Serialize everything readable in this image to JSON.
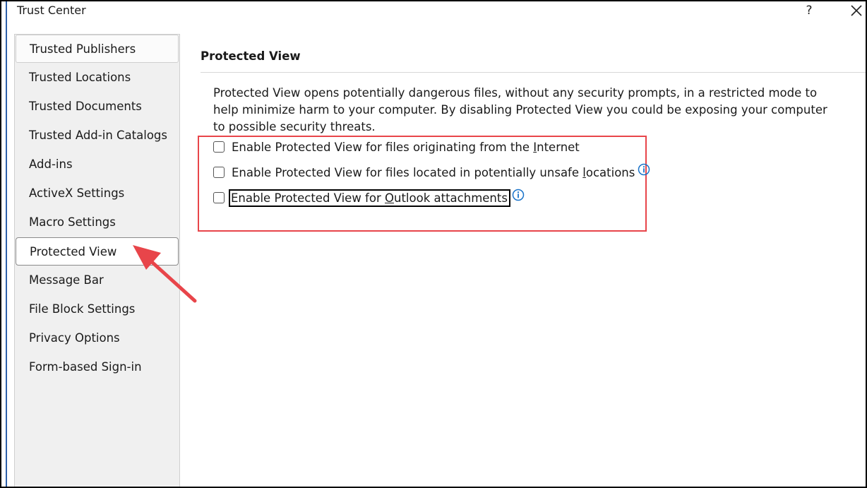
{
  "window": {
    "title": "Trust Center",
    "help_label": "?"
  },
  "sidebar": {
    "items": [
      {
        "label": "Trusted Publishers"
      },
      {
        "label": "Trusted Locations"
      },
      {
        "label": "Trusted Documents"
      },
      {
        "label": "Trusted Add-in Catalogs"
      },
      {
        "label": "Add-ins"
      },
      {
        "label": "ActiveX Settings"
      },
      {
        "label": "Macro Settings"
      },
      {
        "label": "Protected View"
      },
      {
        "label": "Message Bar"
      },
      {
        "label": "File Block Settings"
      },
      {
        "label": "Privacy Options"
      },
      {
        "label": "Form-based Sign-in"
      }
    ],
    "selected_index": 7
  },
  "main": {
    "section_title": "Protected View",
    "description": "Protected View opens potentially dangerous files, without any security prompts, in a restricted mode to help minimize harm to your computer. By disabling Protected View you could be exposing your computer to possible security threats.",
    "options": [
      {
        "pre": "Enable Protected View for files originating from the ",
        "accel": "I",
        "post": "nternet",
        "checked": false,
        "info": false
      },
      {
        "pre": "Enable Protected View for files located in potentially unsafe ",
        "accel": "l",
        "post": "ocations",
        "checked": false,
        "info": true
      },
      {
        "pre": "Enable Protected View for ",
        "accel": "O",
        "post": "utlook attachments",
        "checked": false,
        "info": true
      }
    ]
  },
  "colors": {
    "annotation_red": "#e8454a",
    "info_blue": "#1a73c9",
    "accent_blue": "#2d5fa8"
  }
}
